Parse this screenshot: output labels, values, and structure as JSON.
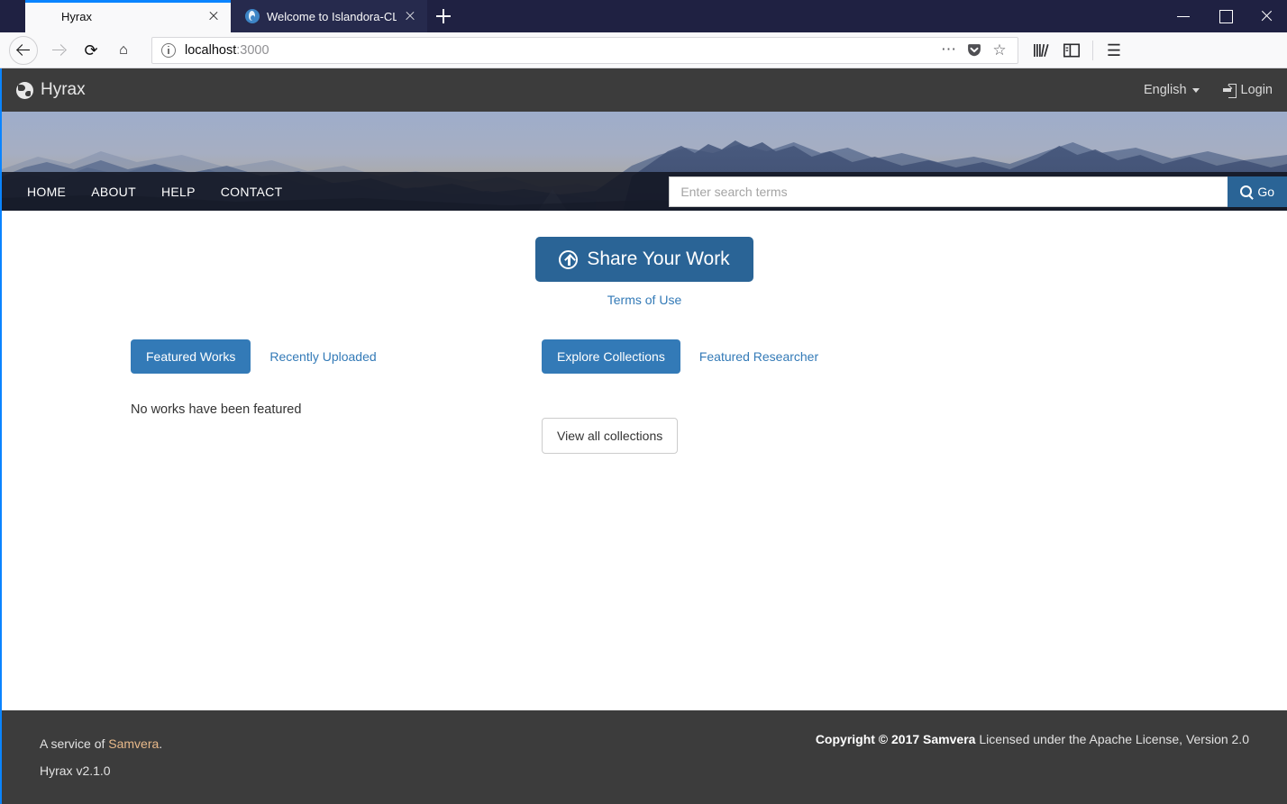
{
  "browser": {
    "tabs": [
      {
        "title": "Hyrax",
        "active": true,
        "favicon": "none"
      },
      {
        "title": "Welcome to Islandora-CLAW | I",
        "active": false,
        "favicon": "drupal-icon"
      }
    ],
    "new_tab_label": "+",
    "window_controls": {
      "minimize": "minimize-icon",
      "maximize": "maximize-icon",
      "close": "close-icon"
    },
    "toolbar": {
      "back": "back-arrow-icon",
      "forward": "forward-arrow-icon",
      "reload": "⟳",
      "home": "⌂",
      "library": "library-icon",
      "sidebar": "sidebar-icon",
      "menu": "☰"
    },
    "url": {
      "host": "localhost",
      "port": ":3000",
      "info_icon": "info-icon"
    },
    "url_actions": {
      "ellipsis": "⋯",
      "pocket": "pocket-icon",
      "bookmark": "☆"
    }
  },
  "site": {
    "brand": "Hyrax",
    "brand_icon": "globe-icon",
    "language": "English",
    "login": "Login",
    "menu": [
      "HOME",
      "ABOUT",
      "HELP",
      "CONTACT"
    ],
    "search": {
      "placeholder": "Enter search terms",
      "value": "",
      "button": "Go"
    }
  },
  "main": {
    "share_button": "Share Your Work",
    "terms_link": "Terms of Use",
    "left_panel": {
      "tabs": [
        {
          "label": "Featured Works",
          "active": true
        },
        {
          "label": "Recently Uploaded",
          "active": false
        }
      ],
      "empty_message": "No works have been featured"
    },
    "right_panel": {
      "tabs": [
        {
          "label": "Explore Collections",
          "active": true
        },
        {
          "label": "Featured Researcher",
          "active": false
        }
      ],
      "view_all_button": "View all collections"
    }
  },
  "footer": {
    "service_prefix": "A service of ",
    "service_link": "Samvera",
    "service_suffix": ".",
    "version": "Hyrax v2.1.0",
    "copyright_bold": "Copyright © 2017",
    "copyright_org": "Samvera",
    "copyright_text": " Licensed under the Apache License, Version 2.0"
  },
  "colors": {
    "primary": "#2a6496",
    "link": "#337ab7",
    "navbar_dark": "#3c3c3c",
    "browser_chrome": "#1f2142",
    "tab_accent": "#0a84ff"
  }
}
